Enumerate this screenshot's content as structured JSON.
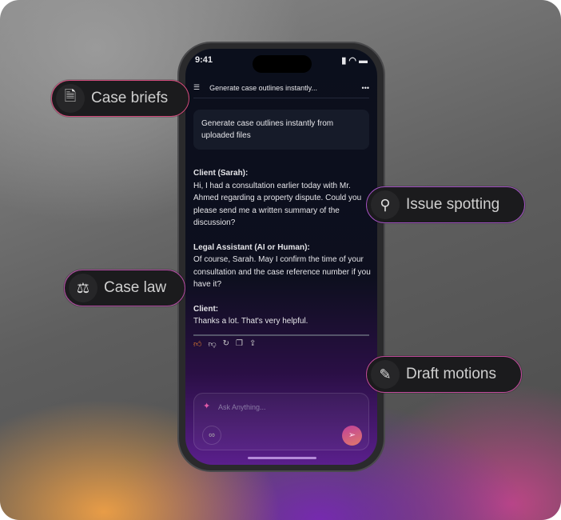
{
  "phone": {
    "time": "9:41",
    "header_title": "Generate case outlines instantly...",
    "prompt": "Generate case outlines instantly from uploaded files",
    "messages": [
      {
        "speaker": "Client (Sarah):",
        "text": "Hi, I had a consultation earlier today with Mr. Ahmed regarding a property dispute. Could you please send me a written summary of the discussion?"
      },
      {
        "speaker": "Legal Assistant (AI or Human):",
        "text": "Of course, Sarah. May I confirm the time of your consultation and the case reference number if you have it?"
      },
      {
        "speaker": "Client:",
        "text": "Thanks a lot. That's very helpful."
      }
    ],
    "input_placeholder": "Ask Anything..."
  },
  "features": {
    "case_briefs": "Case briefs",
    "issue_spotting": "Issue spotting",
    "case_law": "Case law",
    "draft_motions": "Draft motions"
  }
}
